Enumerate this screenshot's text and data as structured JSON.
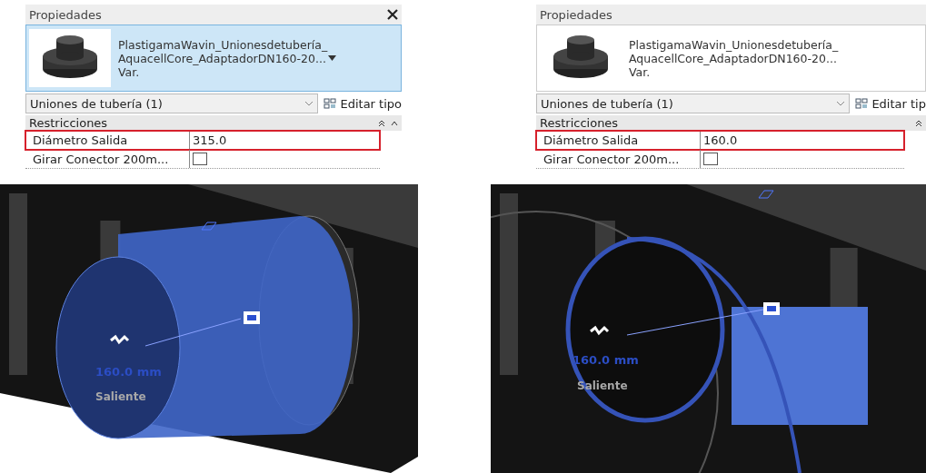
{
  "panels": [
    {
      "properties": {
        "title": "Propiedades",
        "closable": true,
        "type_lines": [
          "PlastigamaWavin_Unionesdetubería_",
          "AquacellCore_AdaptadorDN160-20...",
          "Var."
        ],
        "type_selected": true,
        "category": "Uniones de tubería (1)",
        "edit_type": "Editar tipo",
        "section": "Restricciones",
        "scroll_up": true,
        "rows": [
          {
            "kind": "text",
            "label": "Diámetro Salida",
            "value": "315.0",
            "highlighted": true
          },
          {
            "kind": "checkbox",
            "label": "Girar Conector 200m...",
            "checked": false,
            "highlighted": false
          }
        ]
      },
      "view": {
        "kind": "extended",
        "dimension": "160.0 mm",
        "label": "Saliente"
      }
    },
    {
      "properties": {
        "title": "Propiedades",
        "closable": false,
        "type_lines": [
          "PlastigamaWavin_Unionesdetubería_",
          "AquacellCore_AdaptadorDN160-20...",
          "Var."
        ],
        "type_selected": false,
        "category": "Uniones de tubería (1)",
        "edit_type": "Editar tip",
        "section": "Restricciones",
        "scroll_up": false,
        "rows": [
          {
            "kind": "text",
            "label": "Diámetro Salida",
            "value": "160.0",
            "highlighted": true
          },
          {
            "kind": "checkbox",
            "label": "Girar Conector 200m...",
            "checked": false,
            "highlighted": false
          }
        ]
      },
      "view": {
        "kind": "ring",
        "dimension": "160.0 mm",
        "label": "Saliente"
      }
    }
  ]
}
